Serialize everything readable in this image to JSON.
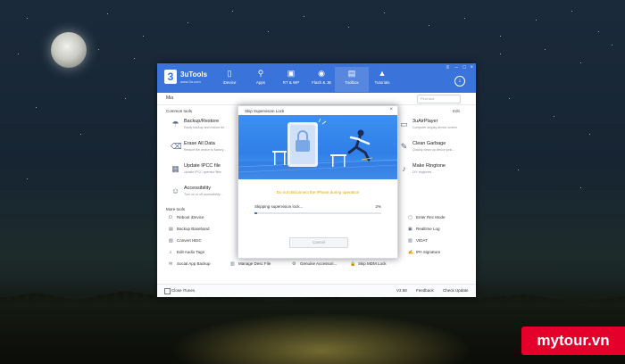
{
  "app": {
    "brand": "3uTools",
    "brand_sub": "www.3u.com",
    "logo_char": "3",
    "nav": [
      {
        "label": "iDevice",
        "icon": "phone-icon"
      },
      {
        "label": "Apps",
        "icon": "apps-icon"
      },
      {
        "label": "RT & WP",
        "icon": "ringtone-icon"
      },
      {
        "label": "Flash & JB",
        "icon": "flash-icon"
      },
      {
        "label": "Toolbox",
        "icon": "toolbox-icon"
      },
      {
        "label": "Tutorials",
        "icon": "tutorials-icon"
      }
    ],
    "active_nav": "Toolbox",
    "device_name": "Mia",
    "find_tool_placeholder": "Find tool",
    "common_tools_title": "Common tools",
    "edit_label": "Edit",
    "more_tools_title": "More tools",
    "common_tools": [
      {
        "name": "Backup/Restore",
        "desc": "Easily backup and restore de..."
      },
      {
        "name": "Erase All Data",
        "desc": "Reduce the device to factory..."
      },
      {
        "name": "Update IPCC file",
        "desc": "Update IPCC operator files"
      },
      {
        "name": "Accessibility",
        "desc": "Turn on or off accessibility..."
      },
      {
        "name": "3uAirPlayer",
        "desc": "Computer display device screen"
      },
      {
        "name": "Clean Garbage",
        "desc": "Quickly clean up device junk..."
      },
      {
        "name": "Make Ringtone",
        "desc": "DIY ringtones"
      }
    ],
    "more_tools": [
      "Reboot iDevice",
      "Backup Baseband",
      "Convert HEIC",
      "Edit Audio Tags",
      "Social App Backup",
      "Manage Desc File",
      "Genuine Accessori...",
      "Skip MDM Lock",
      "Enter Rec Mode",
      "Realtime Log",
      "VIDAT",
      "IPA Signature"
    ],
    "status": {
      "close_itunes": "Close iTunes",
      "version": "V2.58",
      "feedback": "Feedback",
      "check_update": "Check Update"
    }
  },
  "dialog": {
    "title": "Skip Supervision Lock",
    "close_glyph": "×",
    "warning": "Do not disconnect the iPhone during operation",
    "status_text": "Skipping supervision lock...",
    "percent_text": "2%",
    "progress_fraction": 0.02,
    "cancel_label": "Cancel"
  },
  "watermark": "mytour.vn",
  "colors": {
    "accent": "#3a73da",
    "warning": "#e5a100",
    "watermark_bg": "#e4002b"
  }
}
